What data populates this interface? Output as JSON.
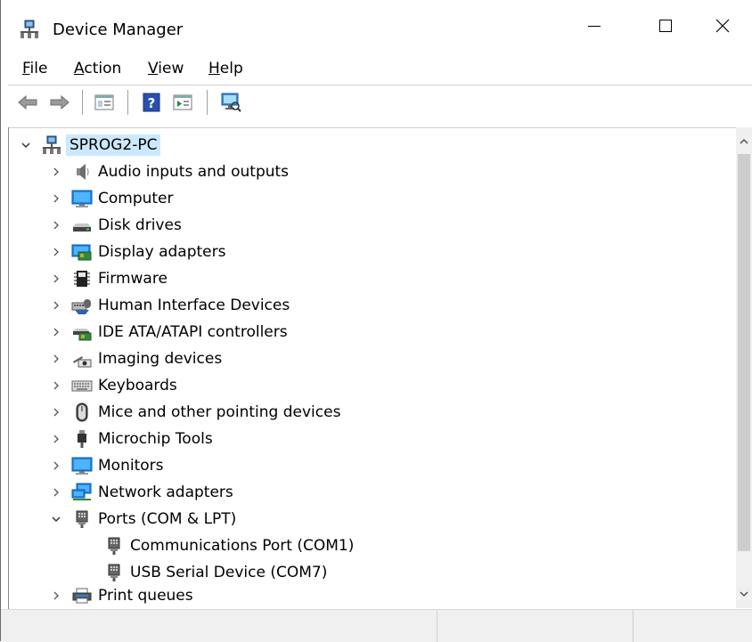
{
  "window": {
    "title": "Device Manager",
    "controls": {
      "minimize": "—",
      "maximize": "☐",
      "close": "✕"
    }
  },
  "menu": [
    {
      "mnemonic": "F",
      "rest": "ile"
    },
    {
      "mnemonic": "A",
      "rest": "ction"
    },
    {
      "mnemonic": "V",
      "rest": "iew"
    },
    {
      "mnemonic": "H",
      "rest": "elp"
    }
  ],
  "toolbar": {
    "icons": [
      "back-arrow-icon",
      "forward-arrow-icon",
      "properties-icon",
      "help-icon",
      "update-driver-icon",
      "scan-hardware-icon"
    ]
  },
  "tree": {
    "root": {
      "label": "SPROG2-PC",
      "expanded": true,
      "icon": "computer-network-icon"
    },
    "categories": [
      {
        "label": "Audio inputs and outputs",
        "icon": "speaker-icon",
        "expanded": false
      },
      {
        "label": "Computer",
        "icon": "monitor-icon",
        "expanded": false
      },
      {
        "label": "Disk drives",
        "icon": "disk-drive-icon",
        "expanded": false
      },
      {
        "label": "Display adapters",
        "icon": "display-adapter-icon",
        "expanded": false
      },
      {
        "label": "Firmware",
        "icon": "chip-icon",
        "expanded": false
      },
      {
        "label": "Human Interface Devices",
        "icon": "hid-icon",
        "expanded": false
      },
      {
        "label": "IDE ATA/ATAPI controllers",
        "icon": "ide-controller-icon",
        "expanded": false
      },
      {
        "label": "Imaging devices",
        "icon": "camera-icon",
        "expanded": false
      },
      {
        "label": "Keyboards",
        "icon": "keyboard-icon",
        "expanded": false
      },
      {
        "label": "Mice and other pointing devices",
        "icon": "mouse-icon",
        "expanded": false
      },
      {
        "label": "Microchip Tools",
        "icon": "usb-plug-icon",
        "expanded": false
      },
      {
        "label": "Monitors",
        "icon": "monitor-icon",
        "expanded": false
      },
      {
        "label": "Network adapters",
        "icon": "network-adapter-icon",
        "expanded": false
      },
      {
        "label": "Ports (COM & LPT)",
        "icon": "port-icon",
        "expanded": true,
        "children": [
          {
            "label": "Communications Port (COM1)",
            "icon": "port-icon"
          },
          {
            "label": "USB Serial Device (COM7)",
            "icon": "port-icon"
          }
        ]
      },
      {
        "label": "Print queues",
        "icon": "printer-icon",
        "expanded": false
      }
    ]
  },
  "colors": {
    "selection": "#cce8ff",
    "accent": "#0078d7"
  }
}
